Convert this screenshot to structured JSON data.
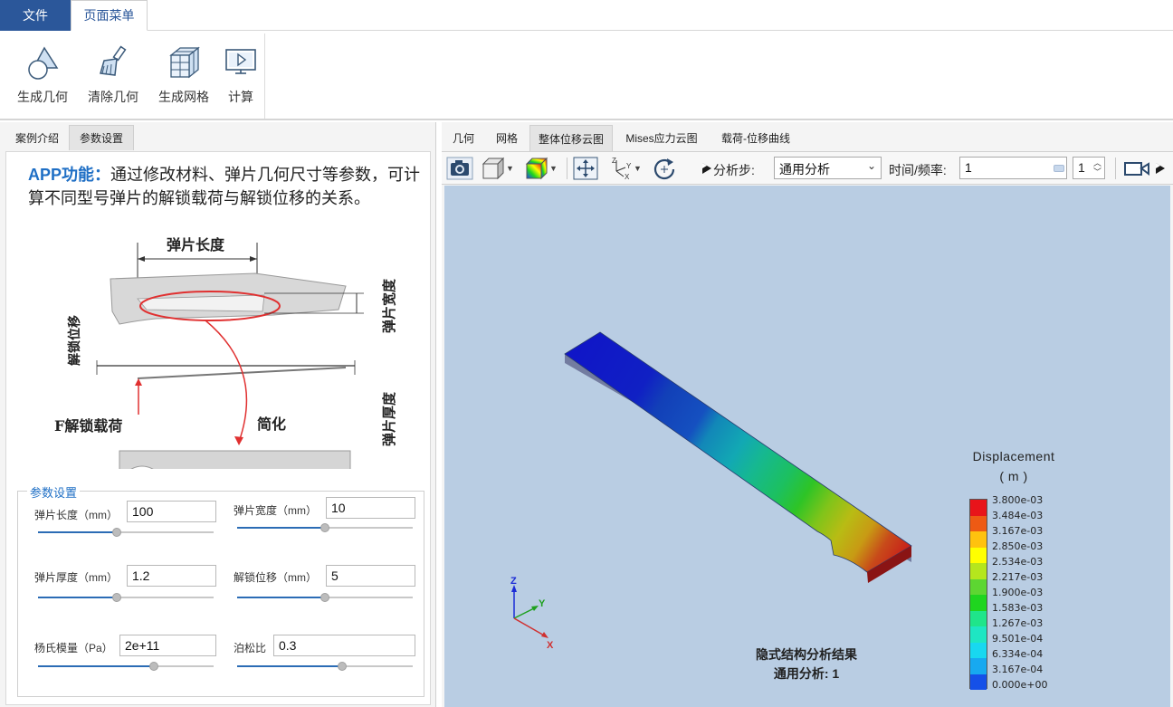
{
  "menu": {
    "file": "文件",
    "page_menu": "页面菜单"
  },
  "ribbon": {
    "buttons": [
      {
        "label": "生成几何",
        "icon": "geometry-shapes-icon"
      },
      {
        "label": "清除几何",
        "icon": "brush-icon"
      },
      {
        "label": "生成网格",
        "icon": "mesh-cube-icon"
      },
      {
        "label": "计算",
        "icon": "monitor-run-icon"
      }
    ]
  },
  "left_tabs": [
    "案例介绍",
    "参数设置"
  ],
  "left_active_tab": "参数设置",
  "app": {
    "heading": "APP功能：",
    "description": "通过修改材料、弹片几何尺寸等参数，可计算不同型号弹片的解锁载荷与解锁位移的关系。"
  },
  "figure": {
    "length_label": "弹片长度",
    "width_label": "弹片宽度",
    "disp_label": "解锁位移",
    "thickness_label": "弹片厚度",
    "load_label": "F解锁载荷",
    "simplify_label": "简化"
  },
  "params": {
    "legend": "参数设置",
    "length": {
      "label": "弹片长度（mm）",
      "value": "100",
      "slider": 0.45
    },
    "width": {
      "label": "弹片宽度（mm）",
      "value": "10",
      "slider": 0.5
    },
    "thickness": {
      "label": "弹片厚度（mm）",
      "value": "1.2",
      "slider": 0.45
    },
    "unlock_disp": {
      "label": "解锁位移（mm）",
      "value": "5",
      "slider": 0.5
    },
    "youngs": {
      "label": "杨氏模量（Pa）",
      "value": "2e+11",
      "slider": 0.66
    },
    "poisson": {
      "label": "泊松比",
      "value": "0.3",
      "slider": 0.6
    }
  },
  "right_tabs": [
    "几何",
    "网格",
    "整体位移云图",
    "Mises应力云图",
    "载荷-位移曲线"
  ],
  "right_active_tab": "整体位移云图",
  "toolbar": {
    "step_label": "分析步:",
    "step_value": "通用分析",
    "time_label": "时间/频率:",
    "time_value": "1",
    "frame_value": "1"
  },
  "result": {
    "legend_title": "Displacement",
    "legend_unit": "( m )",
    "title_line1": "隐式结构分析结果",
    "title_line2": "通用分析: 1",
    "levels": [
      "3.800e-03",
      "3.484e-03",
      "3.167e-03",
      "2.850e-03",
      "2.534e-03",
      "2.217e-03",
      "1.900e-03",
      "1.583e-03",
      "1.267e-03",
      "9.501e-04",
      "6.334e-04",
      "3.167e-04",
      "0.000e+00"
    ],
    "colors": [
      "#e8141a",
      "#ee5a14",
      "#ffc20e",
      "#ffff00",
      "#b5e61d",
      "#5dd632",
      "#1fd51f",
      "#1fe58a",
      "#1ee6c3",
      "#18d8f0",
      "#17a9f0",
      "#1550e8",
      "#1018d6"
    ]
  },
  "axes": {
    "x": "X",
    "y": "Y",
    "z": "Z"
  }
}
